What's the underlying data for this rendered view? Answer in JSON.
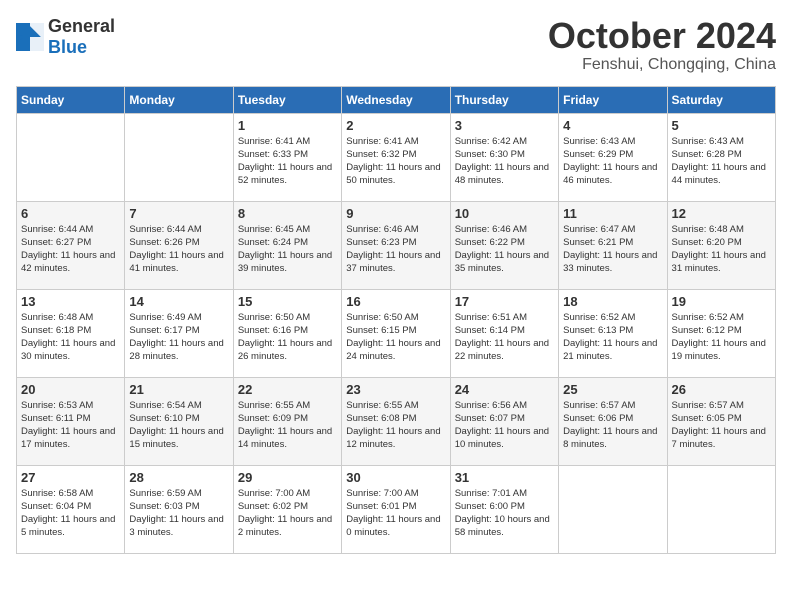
{
  "header": {
    "logo_general": "General",
    "logo_blue": "Blue",
    "month": "October 2024",
    "location": "Fenshui, Chongqing, China"
  },
  "days_of_week": [
    "Sunday",
    "Monday",
    "Tuesday",
    "Wednesday",
    "Thursday",
    "Friday",
    "Saturday"
  ],
  "weeks": [
    [
      {
        "day": "",
        "content": ""
      },
      {
        "day": "",
        "content": ""
      },
      {
        "day": "1",
        "content": "Sunrise: 6:41 AM\nSunset: 6:33 PM\nDaylight: 11 hours and 52 minutes."
      },
      {
        "day": "2",
        "content": "Sunrise: 6:41 AM\nSunset: 6:32 PM\nDaylight: 11 hours and 50 minutes."
      },
      {
        "day": "3",
        "content": "Sunrise: 6:42 AM\nSunset: 6:30 PM\nDaylight: 11 hours and 48 minutes."
      },
      {
        "day": "4",
        "content": "Sunrise: 6:43 AM\nSunset: 6:29 PM\nDaylight: 11 hours and 46 minutes."
      },
      {
        "day": "5",
        "content": "Sunrise: 6:43 AM\nSunset: 6:28 PM\nDaylight: 11 hours and 44 minutes."
      }
    ],
    [
      {
        "day": "6",
        "content": "Sunrise: 6:44 AM\nSunset: 6:27 PM\nDaylight: 11 hours and 42 minutes."
      },
      {
        "day": "7",
        "content": "Sunrise: 6:44 AM\nSunset: 6:26 PM\nDaylight: 11 hours and 41 minutes."
      },
      {
        "day": "8",
        "content": "Sunrise: 6:45 AM\nSunset: 6:24 PM\nDaylight: 11 hours and 39 minutes."
      },
      {
        "day": "9",
        "content": "Sunrise: 6:46 AM\nSunset: 6:23 PM\nDaylight: 11 hours and 37 minutes."
      },
      {
        "day": "10",
        "content": "Sunrise: 6:46 AM\nSunset: 6:22 PM\nDaylight: 11 hours and 35 minutes."
      },
      {
        "day": "11",
        "content": "Sunrise: 6:47 AM\nSunset: 6:21 PM\nDaylight: 11 hours and 33 minutes."
      },
      {
        "day": "12",
        "content": "Sunrise: 6:48 AM\nSunset: 6:20 PM\nDaylight: 11 hours and 31 minutes."
      }
    ],
    [
      {
        "day": "13",
        "content": "Sunrise: 6:48 AM\nSunset: 6:18 PM\nDaylight: 11 hours and 30 minutes."
      },
      {
        "day": "14",
        "content": "Sunrise: 6:49 AM\nSunset: 6:17 PM\nDaylight: 11 hours and 28 minutes."
      },
      {
        "day": "15",
        "content": "Sunrise: 6:50 AM\nSunset: 6:16 PM\nDaylight: 11 hours and 26 minutes."
      },
      {
        "day": "16",
        "content": "Sunrise: 6:50 AM\nSunset: 6:15 PM\nDaylight: 11 hours and 24 minutes."
      },
      {
        "day": "17",
        "content": "Sunrise: 6:51 AM\nSunset: 6:14 PM\nDaylight: 11 hours and 22 minutes."
      },
      {
        "day": "18",
        "content": "Sunrise: 6:52 AM\nSunset: 6:13 PM\nDaylight: 11 hours and 21 minutes."
      },
      {
        "day": "19",
        "content": "Sunrise: 6:52 AM\nSunset: 6:12 PM\nDaylight: 11 hours and 19 minutes."
      }
    ],
    [
      {
        "day": "20",
        "content": "Sunrise: 6:53 AM\nSunset: 6:11 PM\nDaylight: 11 hours and 17 minutes."
      },
      {
        "day": "21",
        "content": "Sunrise: 6:54 AM\nSunset: 6:10 PM\nDaylight: 11 hours and 15 minutes."
      },
      {
        "day": "22",
        "content": "Sunrise: 6:55 AM\nSunset: 6:09 PM\nDaylight: 11 hours and 14 minutes."
      },
      {
        "day": "23",
        "content": "Sunrise: 6:55 AM\nSunset: 6:08 PM\nDaylight: 11 hours and 12 minutes."
      },
      {
        "day": "24",
        "content": "Sunrise: 6:56 AM\nSunset: 6:07 PM\nDaylight: 11 hours and 10 minutes."
      },
      {
        "day": "25",
        "content": "Sunrise: 6:57 AM\nSunset: 6:06 PM\nDaylight: 11 hours and 8 minutes."
      },
      {
        "day": "26",
        "content": "Sunrise: 6:57 AM\nSunset: 6:05 PM\nDaylight: 11 hours and 7 minutes."
      }
    ],
    [
      {
        "day": "27",
        "content": "Sunrise: 6:58 AM\nSunset: 6:04 PM\nDaylight: 11 hours and 5 minutes."
      },
      {
        "day": "28",
        "content": "Sunrise: 6:59 AM\nSunset: 6:03 PM\nDaylight: 11 hours and 3 minutes."
      },
      {
        "day": "29",
        "content": "Sunrise: 7:00 AM\nSunset: 6:02 PM\nDaylight: 11 hours and 2 minutes."
      },
      {
        "day": "30",
        "content": "Sunrise: 7:00 AM\nSunset: 6:01 PM\nDaylight: 11 hours and 0 minutes."
      },
      {
        "day": "31",
        "content": "Sunrise: 7:01 AM\nSunset: 6:00 PM\nDaylight: 10 hours and 58 minutes."
      },
      {
        "day": "",
        "content": ""
      },
      {
        "day": "",
        "content": ""
      }
    ]
  ]
}
